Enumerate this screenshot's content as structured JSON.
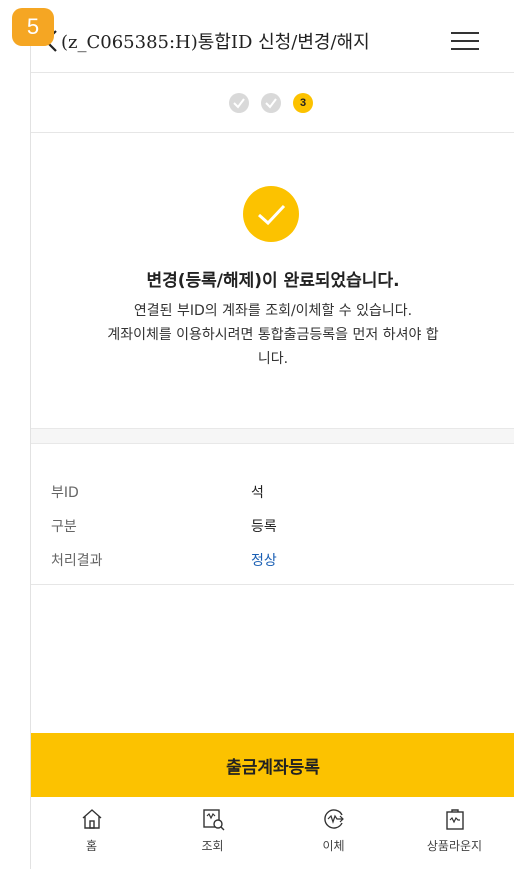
{
  "step_badge": "5",
  "header": {
    "title": "(z_C065385:H)통합ID 신청/변경/해지"
  },
  "progress": {
    "current_step": "3"
  },
  "result": {
    "headline": "변경(등록/해제)이 완료되었습니다.",
    "desc_line1": "연결된 부ID의 계좌를 조회/이체할 수 있습니다.",
    "desc_line2": "계좌이체를 이용하시려면 통합출금등록을 먼저 하셔야 합",
    "desc_line3": "니다."
  },
  "details": [
    {
      "label": "부ID",
      "value": "석"
    },
    {
      "label": "구분",
      "value": "등록"
    },
    {
      "label": "처리결과",
      "value": "정상"
    }
  ],
  "cta_label": "출금계좌등록",
  "colors": {
    "accent": "#fcc200",
    "badge": "#f5a623",
    "status_ok": "#1a5fb4"
  },
  "tabbar": [
    {
      "label": "홈",
      "icon": "home-icon"
    },
    {
      "label": "조회",
      "icon": "inquiry-icon"
    },
    {
      "label": "이체",
      "icon": "transfer-icon"
    },
    {
      "label": "상품라운지",
      "icon": "product-lounge-icon"
    }
  ]
}
